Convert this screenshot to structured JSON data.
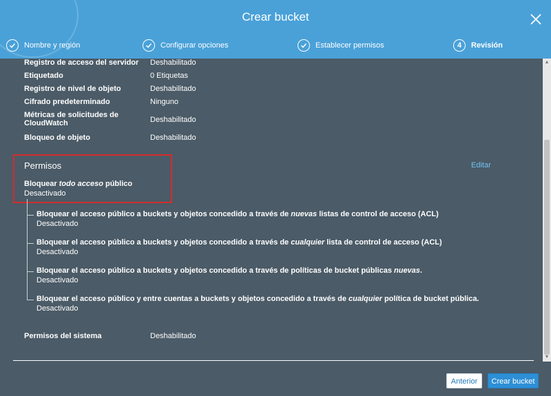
{
  "dialog": {
    "title": "Crear bucket"
  },
  "steps": [
    {
      "label": "Nombre y región",
      "state": "done"
    },
    {
      "label": "Configurar opciones",
      "state": "done"
    },
    {
      "label": "Establecer permisos",
      "state": "done"
    },
    {
      "label": "Revisión",
      "number": "4",
      "state": "active"
    }
  ],
  "options": [
    {
      "key": "Registro de acceso del servidor",
      "value": "Deshabilitado"
    },
    {
      "key": "Etiquetado",
      "value": "0 Etiquetas"
    },
    {
      "key": "Registro de nivel de objeto",
      "value": "Deshabilitado"
    },
    {
      "key": "Cifrado predeterminado",
      "value": "Ninguno"
    },
    {
      "key": "Métricas de solicitudes de",
      "key2": "CloudWatch",
      "value": "Deshabilitado"
    },
    {
      "key": "Bloqueo de objeto",
      "value": "Deshabilitado"
    }
  ],
  "permissions": {
    "title": "Permisos",
    "edit_label": "Editar",
    "block_all": {
      "prefix": "Bloquear ",
      "emph": "todo acceso",
      "suffix": " público",
      "value": "Desactivado"
    },
    "sub_items": [
      {
        "pre": "Bloquear el acceso público a buckets y objetos concedido a través de ",
        "emph": "nuevas",
        "post": " listas de control de acceso (ACL)",
        "value": "Desactivado"
      },
      {
        "pre": "Bloquear el acceso público a buckets y objetos concedido a través de ",
        "emph": "cualquier",
        "post": " lista de control de acceso (ACL)",
        "value": "Desactivado"
      },
      {
        "pre": "Bloquear el acceso público a buckets y objetos concedido a través de políticas de bucket públicas ",
        "emph": "nuevas",
        "post": ".",
        "value": "Desactivado"
      },
      {
        "pre": "Bloquear el acceso público y entre cuentas a buckets y objetos concedido a través de ",
        "emph": "cualquier",
        "post": " política de bucket pública.",
        "value": "Desactivado"
      }
    ],
    "system": {
      "key": "Permisos del sistema",
      "value": "Deshabilitado"
    }
  },
  "footer": {
    "back_label": "Anterior",
    "create_label": "Crear bucket"
  },
  "colors": {
    "header": "#4aa1d8",
    "body": "#4b5b67",
    "accent_button": "#2d8fd6",
    "highlight": "#d62b2b",
    "link": "#6fc3f0"
  }
}
